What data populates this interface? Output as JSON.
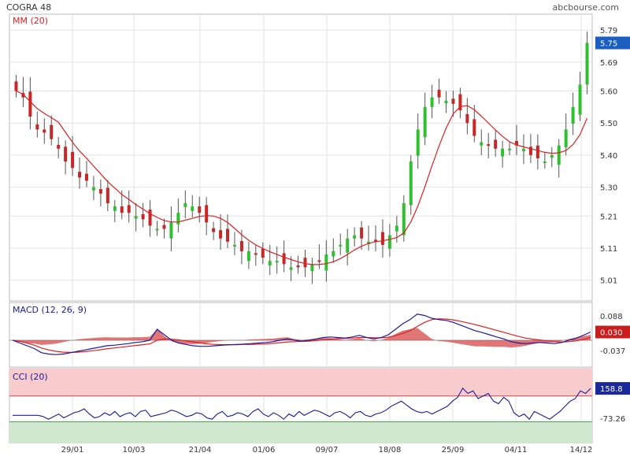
{
  "header": {
    "title": "COGRA 48",
    "source": "abcbourse.com"
  },
  "colors": {
    "up": "#2fc02f",
    "down": "#c62828",
    "ma": "#e02020",
    "macd": "#1a1aa0",
    "signal": "#e02020",
    "hist": "#d64a4a",
    "cci": "#1a1aa0",
    "cci_over": "#f8cccc",
    "cci_under": "#cfe8cf",
    "grid": "#e2e2e2"
  },
  "chart_data": [
    {
      "type": "candlestick",
      "legend": "MM (20)",
      "ylim": [
        4.96,
        5.82
      ],
      "y_ticks": [
        "5.79",
        "5.69",
        "5.60",
        "5.50",
        "5.40",
        "5.30",
        "5.21",
        "5.11",
        "5.01"
      ],
      "x_ticks": [
        "29/01",
        "10/03",
        "21/04",
        "01/06",
        "09/07",
        "18/08",
        "25/09",
        "04/11",
        "14/12"
      ],
      "last_value": "5.75",
      "close_series": [
        5.6,
        5.58,
        5.52,
        5.48,
        5.47,
        5.45,
        5.42,
        5.38,
        5.36,
        5.33,
        5.32,
        5.3,
        5.28,
        5.25,
        5.24,
        5.22,
        5.22,
        5.21,
        5.2,
        5.18,
        5.17,
        5.17,
        5.19,
        5.22,
        5.25,
        5.24,
        5.22,
        5.19,
        5.16,
        5.14,
        5.13,
        5.12,
        5.1,
        5.1,
        5.09,
        5.08,
        5.07,
        5.07,
        5.06,
        5.05,
        5.05,
        5.05,
        5.06,
        5.07,
        5.09,
        5.1,
        5.12,
        5.14,
        5.15,
        5.14,
        5.13,
        5.13,
        5.12,
        5.15,
        5.18,
        5.25,
        5.38,
        5.48,
        5.55,
        5.58,
        5.58,
        5.57,
        5.56,
        5.54,
        5.5,
        5.46,
        5.44,
        5.43,
        5.42,
        5.42,
        5.42,
        5.43,
        5.42,
        5.4,
        5.39,
        5.38,
        5.4,
        5.43,
        5.48,
        5.55,
        5.62,
        5.75
      ],
      "ma_label": "MM (20)"
    },
    {
      "type": "line",
      "legend": "MACD (12, 26, 9)",
      "ylim": [
        -0.08,
        0.12
      ],
      "y_ticks": [
        "0.088",
        "-0.037"
      ],
      "last_value": "0.030",
      "macd": [
        0.0,
        -0.01,
        -0.02,
        -0.03,
        -0.045,
        -0.05,
        -0.052,
        -0.05,
        -0.045,
        -0.04,
        -0.035,
        -0.03,
        -0.025,
        -0.02,
        -0.018,
        -0.015,
        -0.012,
        -0.008,
        -0.005,
        0.0,
        0.04,
        0.02,
        0.0,
        -0.01,
        -0.015,
        -0.02,
        -0.022,
        -0.022,
        -0.02,
        -0.018,
        -0.016,
        -0.015,
        -0.014,
        -0.012,
        -0.01,
        -0.008,
        -0.005,
        0.0,
        0.005,
        0.0,
        -0.003,
        0.0,
        0.005,
        0.01,
        0.012,
        0.01,
        0.008,
        0.012,
        0.018,
        0.01,
        0.005,
        0.01,
        0.02,
        0.04,
        0.06,
        0.075,
        0.095,
        0.09,
        0.08,
        0.075,
        0.072,
        0.065,
        0.055,
        0.045,
        0.035,
        0.028,
        0.02,
        0.012,
        0.005,
        -0.005,
        -0.01,
        -0.012,
        -0.01,
        -0.008,
        -0.01,
        -0.012,
        -0.008,
        0.0,
        0.008,
        0.018,
        0.03
      ],
      "signal": [
        0.0,
        -0.004,
        -0.01,
        -0.018,
        -0.028,
        -0.035,
        -0.04,
        -0.043,
        -0.044,
        -0.043,
        -0.041,
        -0.038,
        -0.035,
        -0.031,
        -0.028,
        -0.025,
        -0.022,
        -0.019,
        -0.016,
        -0.013,
        0.0,
        0.005,
        0.004,
        0.001,
        -0.002,
        -0.006,
        -0.01,
        -0.013,
        -0.015,
        -0.016,
        -0.016,
        -0.016,
        -0.015,
        -0.015,
        -0.014,
        -0.013,
        -0.011,
        -0.009,
        -0.006,
        -0.005,
        -0.004,
        -0.003,
        -0.001,
        0.002,
        0.004,
        0.006,
        0.007,
        0.008,
        0.01,
        0.01,
        0.009,
        0.009,
        0.011,
        0.017,
        0.025,
        0.035,
        0.05,
        0.065,
        0.075,
        0.078,
        0.077,
        0.074,
        0.069,
        0.063,
        0.057,
        0.05,
        0.043,
        0.036,
        0.029,
        0.021,
        0.014,
        0.008,
        0.004,
        0.001,
        -0.002,
        -0.005,
        -0.006,
        -0.005,
        -0.002,
        0.003,
        0.01
      ]
    },
    {
      "type": "line",
      "legend": "CCI (20)",
      "ylim": [
        -250,
        300
      ],
      "y_ticks": [
        "-73.26"
      ],
      "last_value": "158.8",
      "cci": [
        -50,
        -50,
        -50,
        -50,
        -50,
        -50,
        -60,
        -80,
        -60,
        -40,
        -70,
        -50,
        -30,
        -20,
        0,
        -40,
        -70,
        -60,
        -30,
        -50,
        -20,
        -60,
        -40,
        -30,
        -60,
        -20,
        -10,
        -60,
        -50,
        -40,
        -30,
        -10,
        -20,
        -40,
        -60,
        -50,
        -30,
        -40,
        -70,
        -80,
        -40,
        -20,
        -60,
        -50,
        -30,
        -40,
        -60,
        -20,
        0,
        -40,
        -60,
        -30,
        -50,
        -80,
        -40,
        -60,
        -20,
        -50,
        -30,
        -10,
        -20,
        -40,
        -60,
        -30,
        -20,
        -40,
        -70,
        -30,
        -20,
        -50,
        -60,
        -40,
        -30,
        -10,
        20,
        40,
        60,
        30,
        0,
        -20,
        -30,
        -20,
        -40,
        -20,
        0,
        20,
        60,
        90,
        160,
        120,
        140,
        80,
        100,
        120,
        60,
        40,
        90,
        60,
        -30,
        -60,
        -40,
        -80,
        -20,
        -40,
        -60,
        -80,
        -50,
        -20,
        20,
        60,
        80,
        140,
        120,
        158.8
      ]
    }
  ]
}
